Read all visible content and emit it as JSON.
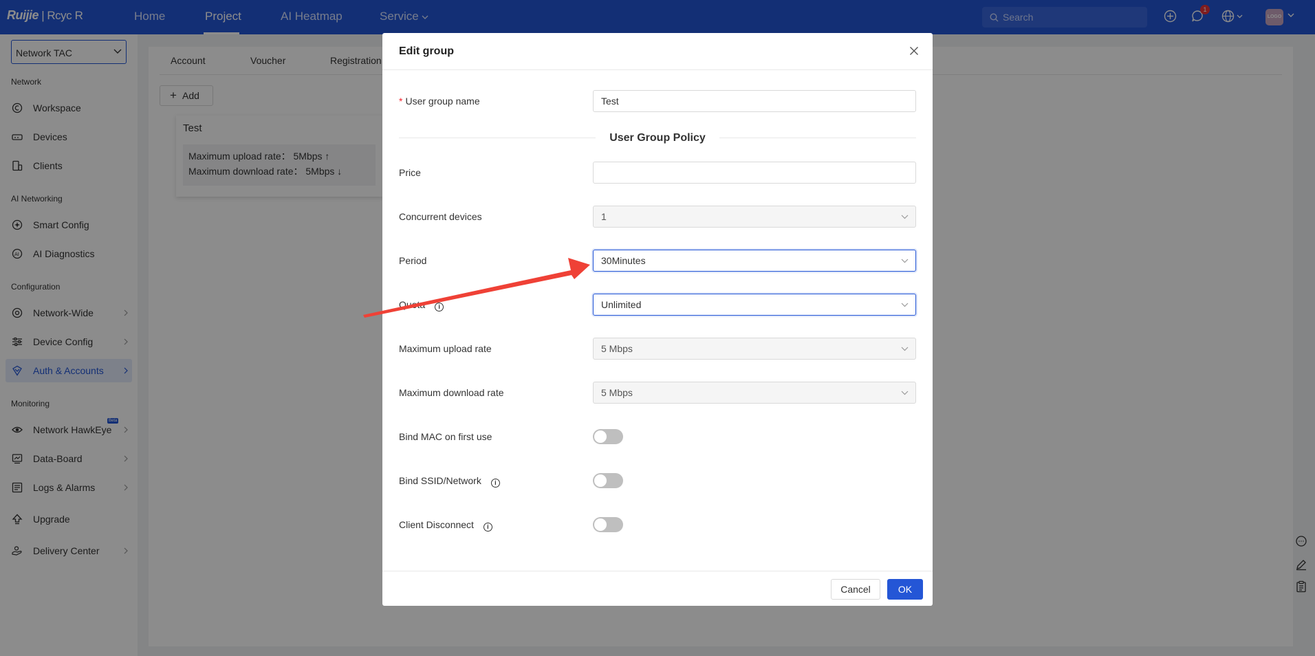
{
  "brand": {
    "logo_main": "Ruijie",
    "logo_sep": " | Rcyc",
    "logo_mark": "R"
  },
  "topnav": {
    "items": [
      "Home",
      "Project",
      "AI Heatmap",
      "Service"
    ],
    "active": "Project",
    "search_placeholder": "Search",
    "notification_count": "1",
    "avatar_text": "LOGO"
  },
  "sidebar": {
    "project_select": "Network TAC",
    "sections": [
      {
        "title": "Network",
        "items": [
          {
            "label": "Workspace",
            "icon": "workspace-icon"
          },
          {
            "label": "Devices",
            "icon": "devices-icon"
          },
          {
            "label": "Clients",
            "icon": "clients-icon"
          }
        ]
      },
      {
        "title": "AI Networking",
        "items": [
          {
            "label": "Smart Config",
            "icon": "smart-config-icon"
          },
          {
            "label": "AI Diagnostics",
            "icon": "ai-diagnostics-icon"
          }
        ]
      },
      {
        "title": "Configuration",
        "items": [
          {
            "label": "Network-Wide",
            "icon": "network-wide-icon"
          },
          {
            "label": "Device Config",
            "icon": "device-config-icon"
          },
          {
            "label": "Auth & Accounts",
            "icon": "auth-accounts-icon",
            "active": true
          }
        ]
      },
      {
        "title": "Monitoring",
        "items": [
          {
            "label": "Network HawkEye",
            "icon": "hawkeye-icon",
            "badge": "Beta"
          },
          {
            "label": "Data-Board",
            "icon": "data-board-icon"
          },
          {
            "label": "Logs & Alarms",
            "icon": "logs-alarms-icon"
          },
          {
            "label": "Upgrade",
            "icon": "upgrade-icon"
          },
          {
            "label": "Delivery Center",
            "icon": "delivery-center-icon"
          }
        ]
      }
    ]
  },
  "main": {
    "tabs": [
      "Account",
      "Voucher",
      "Registration"
    ],
    "add_label": "Add",
    "card": {
      "title": "Test",
      "upload": "Maximum upload rate： 5Mbps ↑",
      "download": "Maximum download rate： 5Mbps ↓"
    }
  },
  "modal": {
    "title": "Edit group",
    "fields": {
      "group_name": {
        "label": "User group name",
        "required": true,
        "value": "Test"
      },
      "policy_title": "User Group Policy",
      "price": {
        "label": "Price",
        "value": ""
      },
      "concurrent": {
        "label": "Concurrent devices",
        "value": "1"
      },
      "period": {
        "label": "Period",
        "value": "30Minutes"
      },
      "quota": {
        "label": "Quota",
        "value": "Unlimited"
      },
      "upload": {
        "label": "Maximum upload rate",
        "value": "5 Mbps"
      },
      "download": {
        "label": "Maximum download rate",
        "value": "5 Mbps"
      },
      "bind_mac": {
        "label": "Bind MAC on first use",
        "enabled": false
      },
      "bind_ssid": {
        "label": "Bind SSID/Network",
        "enabled": false
      },
      "client_disconnect": {
        "label": "Client Disconnect",
        "enabled": false
      }
    },
    "cancel_label": "Cancel",
    "ok_label": "OK"
  },
  "colors": {
    "brand_blue": "#2456d6",
    "annotation_arrow": "#ef4136",
    "toggle_off": "#bfbfbf"
  }
}
